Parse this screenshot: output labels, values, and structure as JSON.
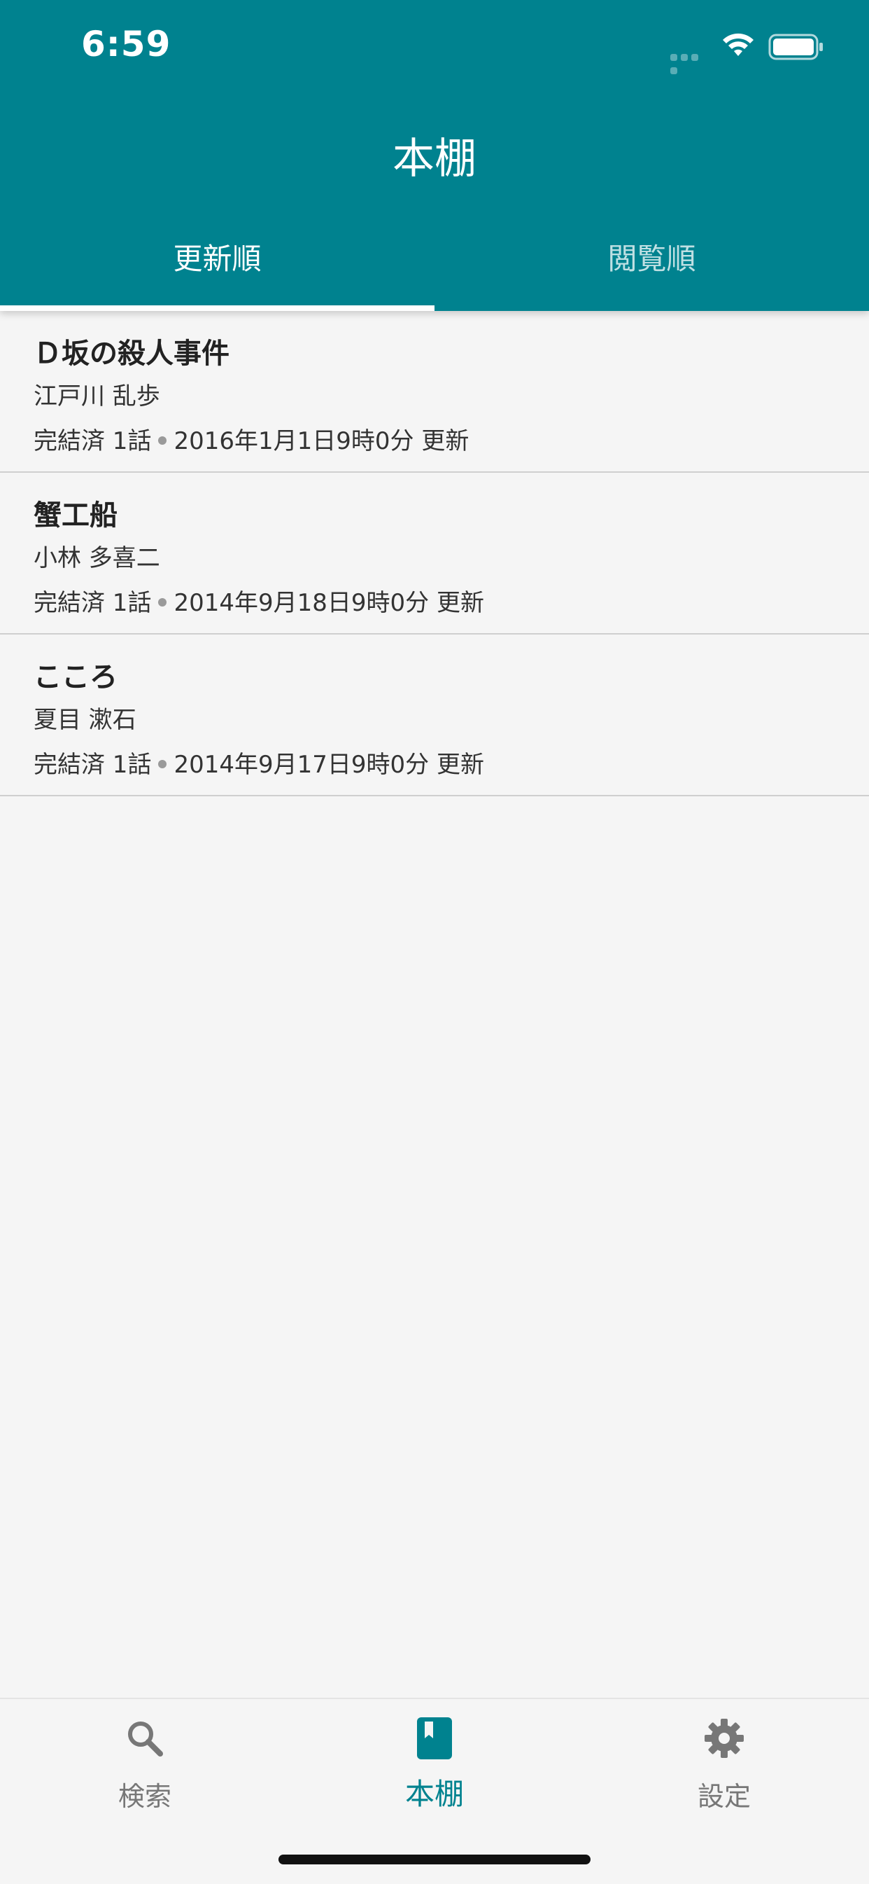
{
  "status_bar": {
    "time": "6:59"
  },
  "header": {
    "title": "本棚",
    "tabs": [
      {
        "label": "更新順",
        "active": true
      },
      {
        "label": "閲覧順",
        "active": false
      }
    ],
    "color": "#00828f"
  },
  "books": [
    {
      "title": "Ｄ坂の殺人事件",
      "author": "江戸川 乱歩",
      "status": "完結済 1話",
      "updated": "2016年1月1日9時0分 更新"
    },
    {
      "title": "蟹工船",
      "author": "小林 多喜二",
      "status": "完結済 1話",
      "updated": "2014年9月18日9時0分 更新"
    },
    {
      "title": "こころ",
      "author": "夏目 漱石",
      "status": "完結済 1話",
      "updated": "2014年9月17日9時0分 更新"
    }
  ],
  "bottom_nav": {
    "items": [
      {
        "label": "検索",
        "icon": "search-icon",
        "active": false
      },
      {
        "label": "本棚",
        "icon": "book-icon",
        "active": true
      },
      {
        "label": "設定",
        "icon": "gear-icon",
        "active": false
      }
    ],
    "active_color": "#00828f"
  }
}
